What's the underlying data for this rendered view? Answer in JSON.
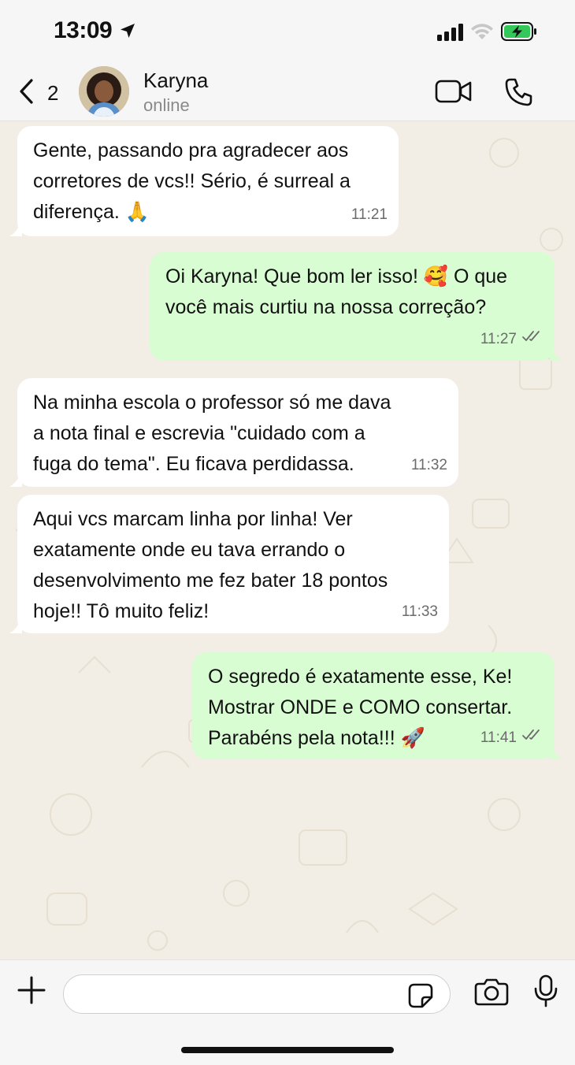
{
  "status_bar": {
    "time": "13:09",
    "icons": [
      "location-arrow-icon",
      "signal-icon",
      "wifi-icon",
      "battery-charging-icon"
    ]
  },
  "header": {
    "back_count": "2",
    "contact_name": "Karyna",
    "contact_status": "online",
    "icons": [
      "chevron-left-icon",
      "video-call-icon",
      "phone-call-icon"
    ]
  },
  "messages": [
    {
      "direction": "in",
      "lines": [
        "Gente, passando pra agradecer aos",
        "corretores de vcs!! Sério, é surreal a",
        "diferença. 🙏"
      ],
      "time": "11:21"
    },
    {
      "direction": "out",
      "lines": [
        "Oi Karyna! Que bom ler isso! 🥰 O que",
        "você mais curtiu na nossa correção?"
      ],
      "time": "11:27",
      "read": true
    },
    {
      "direction": "in",
      "lines": [
        "Na minha escola o professor só me dava",
        "a nota final e escrevia \"cuidado com a",
        "fuga do tema\". Eu ficava perdidassa."
      ],
      "time": "11:32"
    },
    {
      "direction": "in",
      "lines": [
        "Aqui vcs marcam linha por linha! Ver",
        "exatamente onde eu tava errando o",
        "desenvolvimento me fez bater 18 pontos",
        "hoje!! Tô muito feliz!"
      ],
      "time": "11:33"
    },
    {
      "direction": "out",
      "lines": [
        "O segredo é exatamente esse, Ke!",
        "Mostrar ONDE e COMO consertar.",
        "Parabéns pela nota!!! 🚀"
      ],
      "time": "11:41",
      "read": true
    }
  ],
  "input": {
    "value": "",
    "placeholder": "",
    "icons": [
      "plus-icon",
      "sticker-icon",
      "camera-icon",
      "microphone-icon"
    ]
  },
  "colors": {
    "incoming_bubble": "#ffffff",
    "outgoing_bubble": "#d9fdd3",
    "read_check": "#6b6b6b",
    "chat_background": "#f3eee5"
  }
}
